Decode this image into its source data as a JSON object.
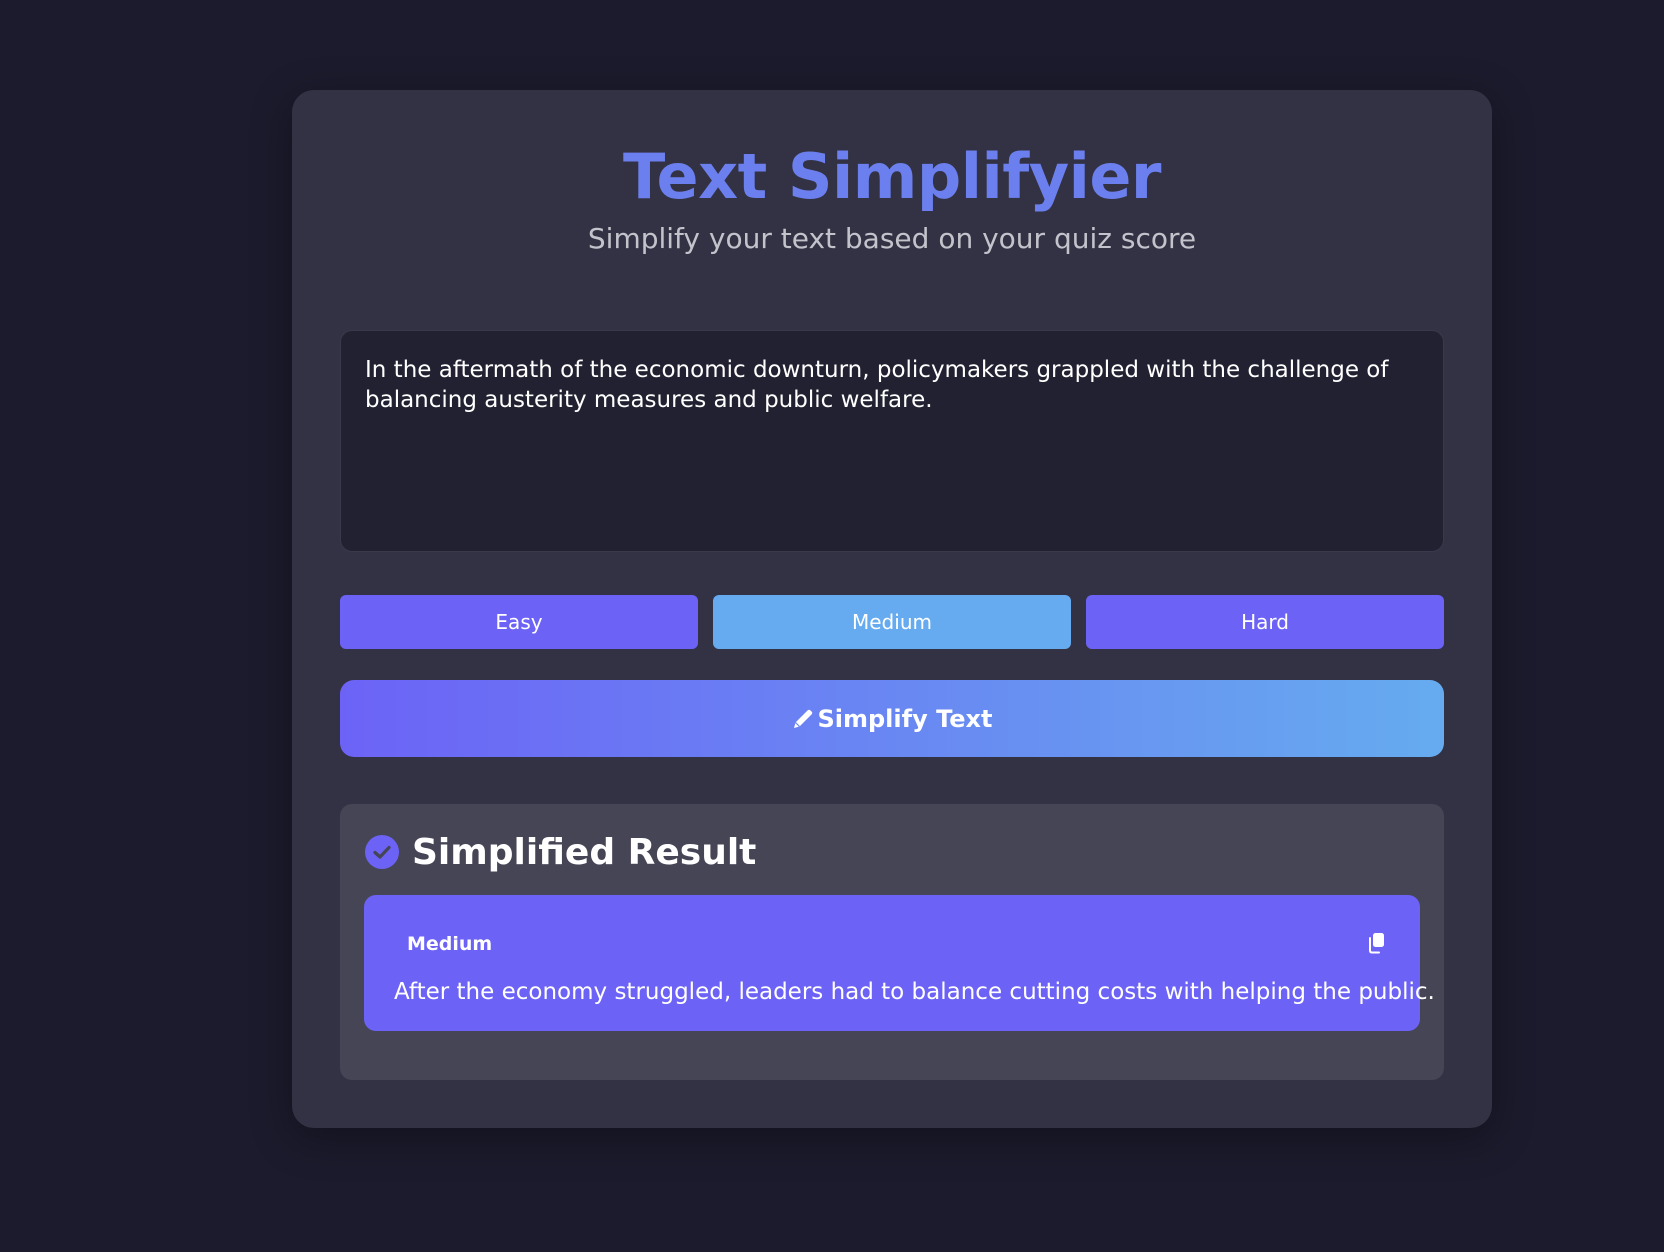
{
  "header": {
    "title": "Text Simplifyier",
    "subtitle": "Simplify your text based on your quiz score"
  },
  "input": {
    "value": "In the aftermath of the economic downturn, policymakers grappled with the challenge of balancing austerity measures and public welfare."
  },
  "levels": {
    "options": [
      "Easy",
      "Medium",
      "Hard"
    ],
    "selected": "Medium"
  },
  "simplify_button": {
    "label": "Simplify Text",
    "icon": "pencil-icon"
  },
  "result": {
    "title": "Simplified Result",
    "title_icon": "check-circle-icon",
    "level": "Medium",
    "copy_icon": "copy-icon",
    "text": "After the economy struggled, leaders had to balance cutting costs with helping the public."
  },
  "colors": {
    "background": "#1b1b2d",
    "card": "#333244",
    "accent": "#6c63f6",
    "accent_light": "#66abef",
    "title": "#6b80ee"
  }
}
